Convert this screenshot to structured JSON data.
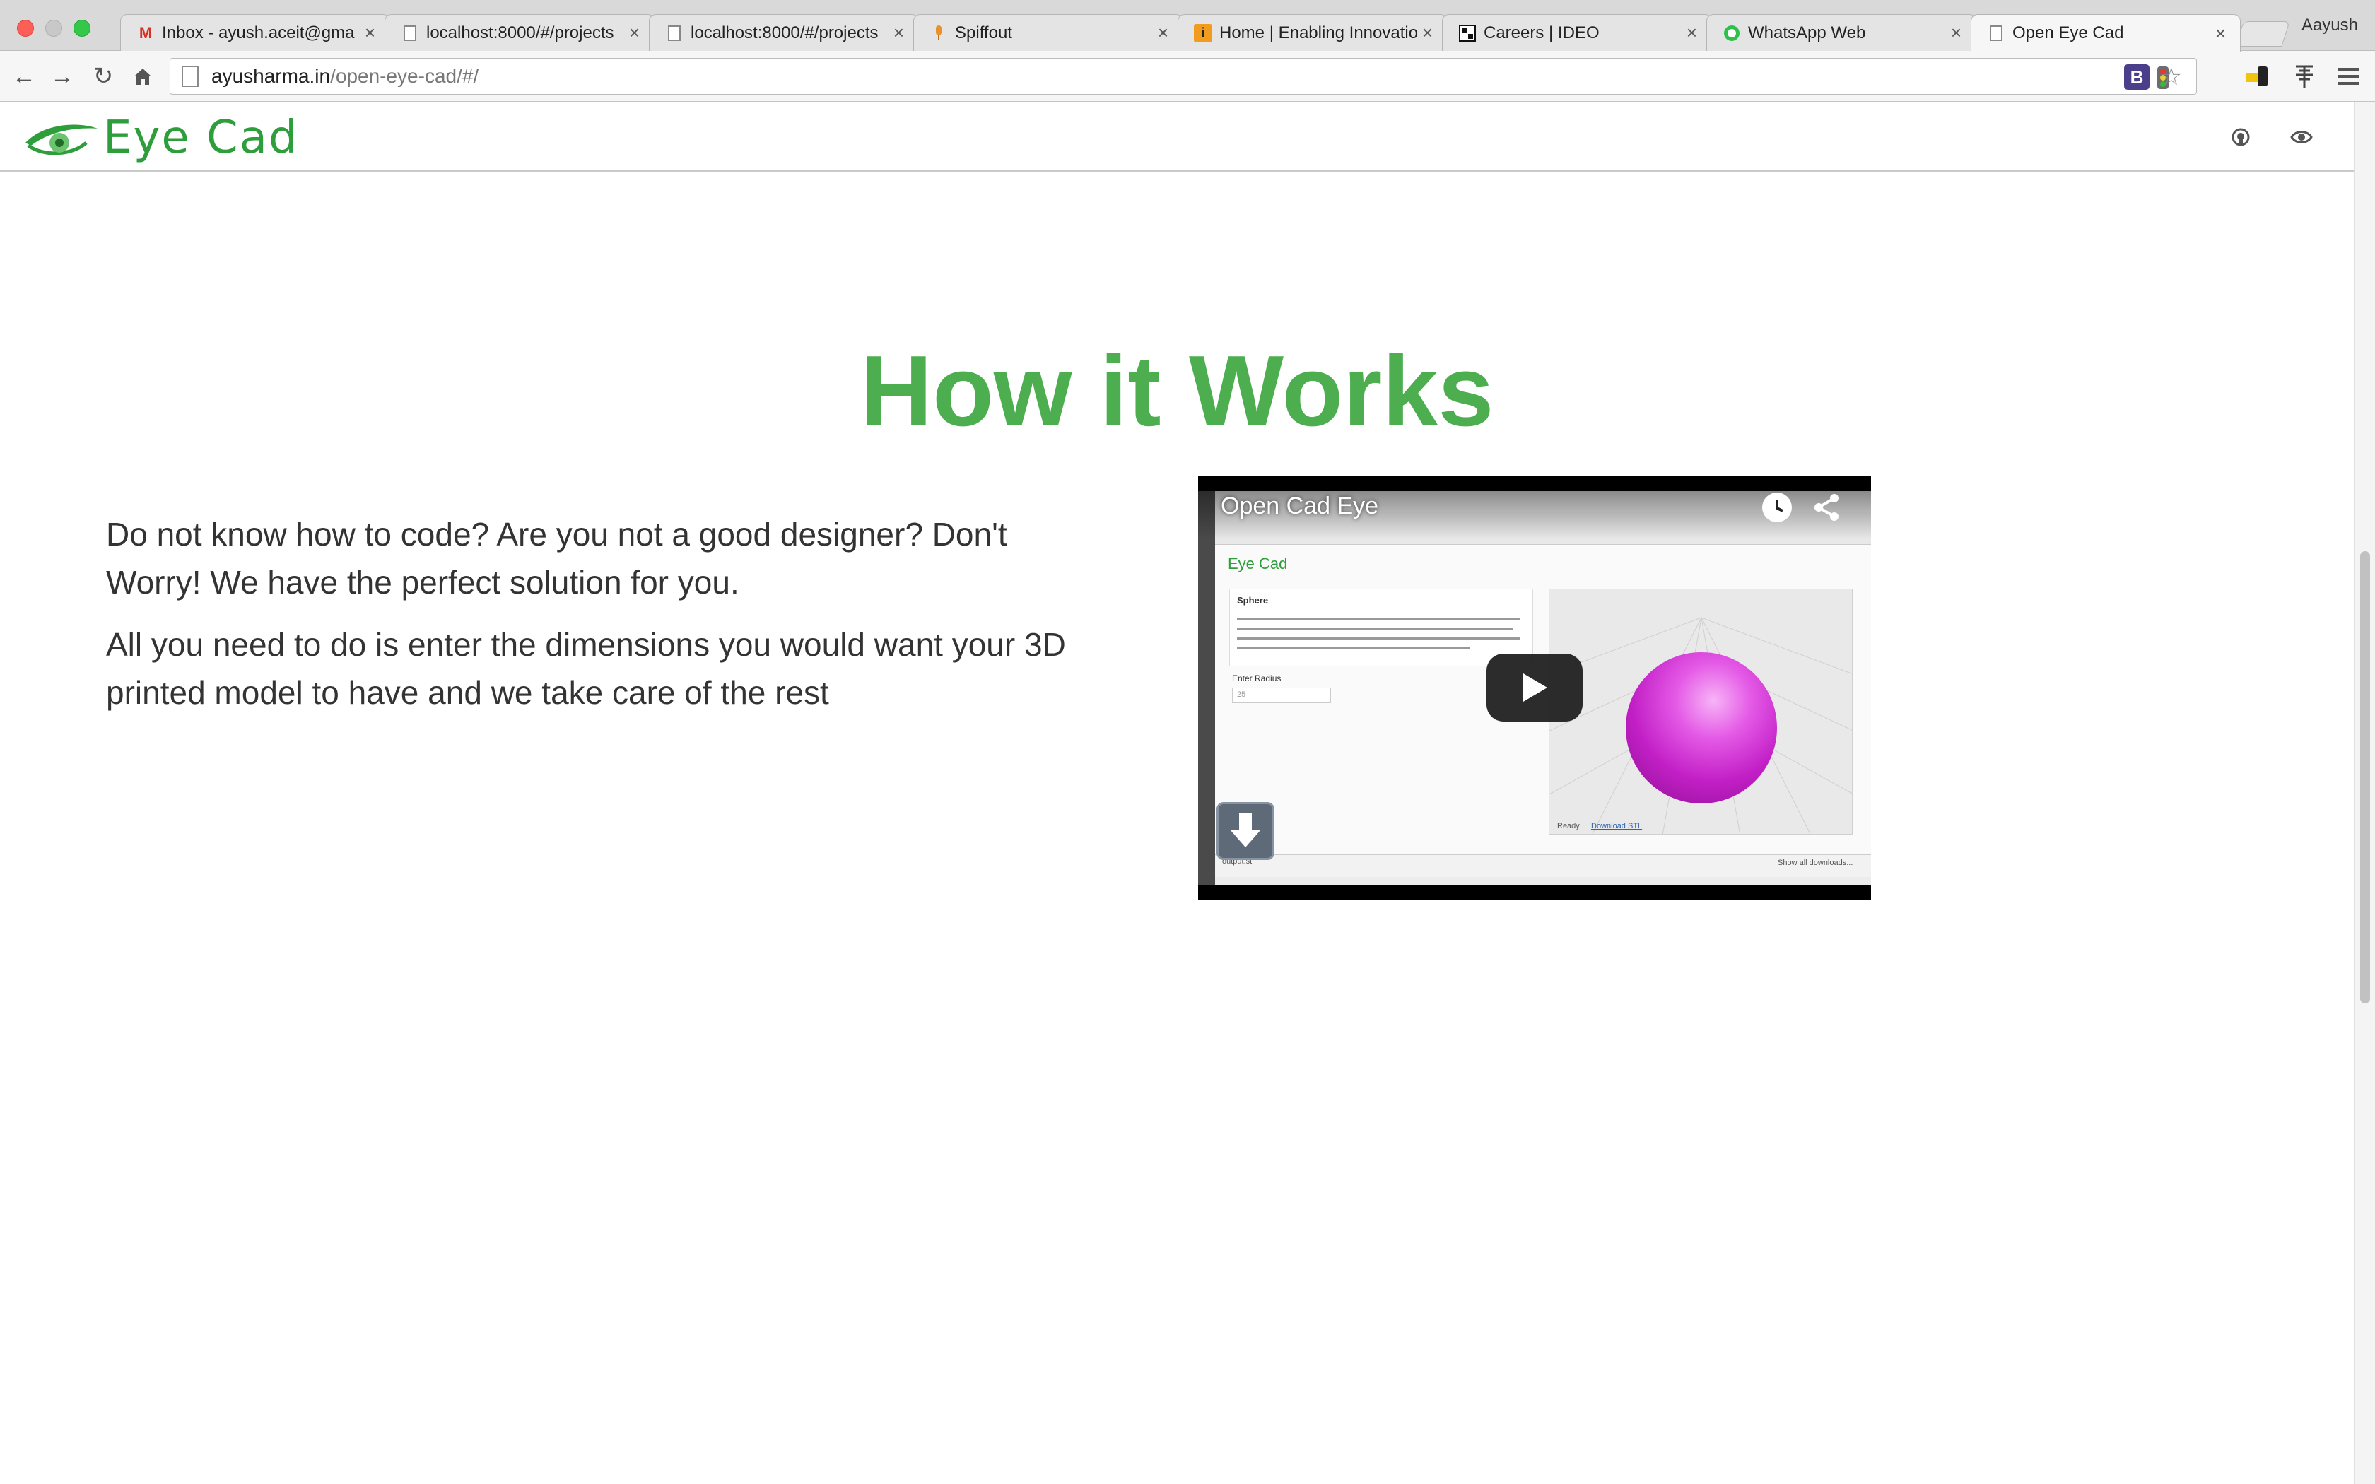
{
  "browser": {
    "tabs": [
      {
        "title": "Inbox - ayush.aceit@gma",
        "favicon": "gmail-icon",
        "active": false
      },
      {
        "title": "localhost:8000/#/projects",
        "favicon": "page-icon",
        "active": false
      },
      {
        "title": "localhost:8000/#/projects",
        "favicon": "page-icon",
        "active": false
      },
      {
        "title": "Spiffout",
        "favicon": "mic-icon",
        "active": false
      },
      {
        "title": "Home | Enabling Innovatio",
        "favicon": "orange-i-icon",
        "active": false
      },
      {
        "title": "Careers | IDEO",
        "favicon": "ideo-icon",
        "active": false
      },
      {
        "title": "WhatsApp Web",
        "favicon": "whatsapp-icon",
        "active": false
      },
      {
        "title": "Open Eye Cad",
        "favicon": "page-icon",
        "active": true
      }
    ],
    "tab_close": "×",
    "profile_name": "Aayush",
    "url_host": "ayusharma.in",
    "url_path": "/open-eye-cad/#/"
  },
  "site": {
    "logo_text": "Eye Cad",
    "brand_color": "#4cae4f",
    "header_icons": [
      "github-icon",
      "eye-icon"
    ]
  },
  "section": {
    "title": "How it Works",
    "paragraph_1": "Do not know how to code? Are you not a good designer? Don't Worry! We have the perfect solution for you.",
    "paragraph_2": "All you need to do is enter the dimensions you would want your 3D printed model to have and we take care of the rest"
  },
  "video": {
    "title": "Open Cad Eye",
    "inner_logo": "Eye Cad",
    "inner_panel_title": "Sphere",
    "inner_label": "Enter Radius",
    "inner_input_value": "25",
    "inner_status": "Ready",
    "inner_download": "Download STL",
    "inner_file": "output.stl",
    "inner_show_all": "Show all downloads..."
  }
}
